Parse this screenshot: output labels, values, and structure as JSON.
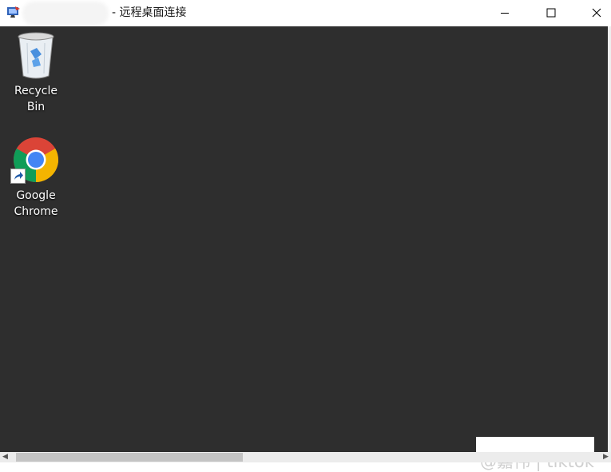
{
  "window": {
    "title": "- 远程桌面连接",
    "controls": {
      "minimize": "minimize-icon",
      "maximize": "maximize-icon",
      "close": "close-icon"
    }
  },
  "desktop": {
    "icons": [
      {
        "label": "Recycle Bin",
        "icon": "recycle-bin-icon"
      },
      {
        "label": "Google\nChrome",
        "icon": "chrome-icon"
      }
    ]
  },
  "watermark": {
    "site": "知乎",
    "author": "@嘉伟 | tiktok"
  },
  "colors": {
    "desktop_bg": "#2e2e2e",
    "titlebar_bg": "#ffffff"
  }
}
